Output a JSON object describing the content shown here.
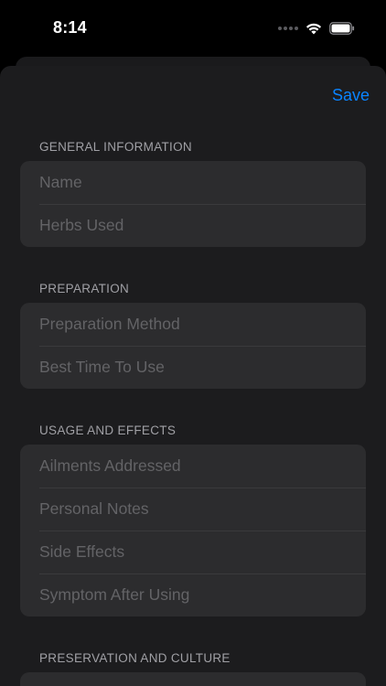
{
  "status": {
    "time": "8:14"
  },
  "toolbar": {
    "save_label": "Save"
  },
  "sections": [
    {
      "header": "GENERAL INFORMATION",
      "fields": [
        {
          "placeholder": "Name",
          "value": ""
        },
        {
          "placeholder": "Herbs Used",
          "value": ""
        }
      ]
    },
    {
      "header": "PREPARATION",
      "fields": [
        {
          "placeholder": "Preparation Method",
          "value": ""
        },
        {
          "placeholder": "Best Time To Use",
          "value": ""
        }
      ]
    },
    {
      "header": "USAGE AND EFFECTS",
      "fields": [
        {
          "placeholder": "Ailments Addressed",
          "value": ""
        },
        {
          "placeholder": "Personal Notes",
          "value": ""
        },
        {
          "placeholder": "Side Effects",
          "value": ""
        },
        {
          "placeholder": "Symptom After Using",
          "value": ""
        }
      ]
    },
    {
      "header": "PRESERVATION AND CULTURE",
      "fields": []
    }
  ],
  "colors": {
    "accent": "#0a84ff",
    "sheet_background": "#1c1c1e",
    "group_background": "#2c2c2e",
    "placeholder": "#636366"
  }
}
